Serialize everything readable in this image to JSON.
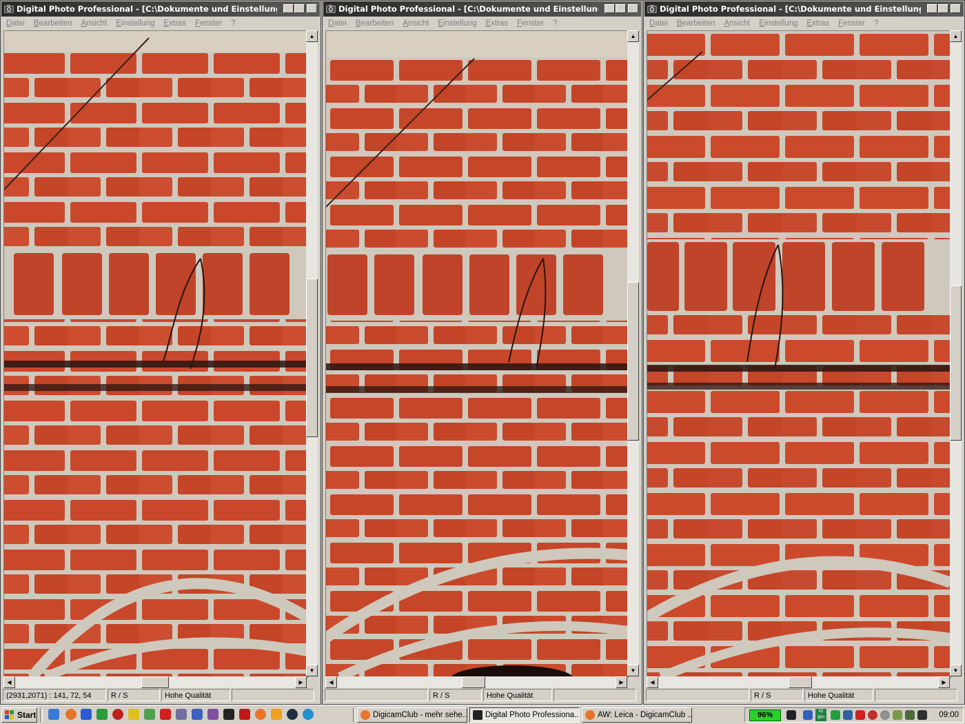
{
  "windows": [
    {
      "title": "Digital Photo Professional - [C:\\Dokumente und Einstellungen\\HH\\...",
      "status": {
        "coords": "(2931,2071) : 141, 72, 54",
        "mode": "R / S",
        "quality": "Hohe Qualität"
      }
    },
    {
      "title": "Digital Photo Professional - [C:\\Dokumente und Einstellungen\\HH\\...",
      "status": {
        "coords": "",
        "mode": "R / S",
        "quality": "Hohe Qualität"
      }
    },
    {
      "title": "Digital Photo Professional - [C:\\Dokumente und Einstellungen\\HH\\...",
      "status": {
        "coords": "",
        "mode": "R / S",
        "quality": "Hohe Qualität"
      }
    }
  ],
  "menu": [
    "Datei",
    "Bearbeiten",
    "Ansicht",
    "Einstellung",
    "Extras",
    "Fenster",
    "?"
  ],
  "image_description_colors": {
    "brick": "#c9482c",
    "mortar": "#cfc8bc"
  },
  "taskbar": {
    "start_label": "Start",
    "quicklaunch_icons": [
      "ie-icon",
      "firefox-icon",
      "word-icon",
      "excel-icon",
      "app-icon",
      "app-icon",
      "app-icon",
      "acrobat-icon",
      "app-icon",
      "app-icon",
      "app-icon",
      "camera-icon",
      "filezilla-icon",
      "firefox-icon",
      "app-icon",
      "app-icon",
      "app-icon"
    ],
    "tasks": [
      {
        "label": "DigicamClub - mehr sehe...",
        "icon": "firefox-icon",
        "active": false
      },
      {
        "label": "Digital Photo Professiona...",
        "icon": "camera-icon",
        "active": true
      },
      {
        "label": "AW: Leica - DigicamClub ...",
        "icon": "firefox-icon",
        "active": false
      }
    ],
    "battery": "96%",
    "tray_gpu": "52 gpu",
    "clock": "09:00"
  }
}
